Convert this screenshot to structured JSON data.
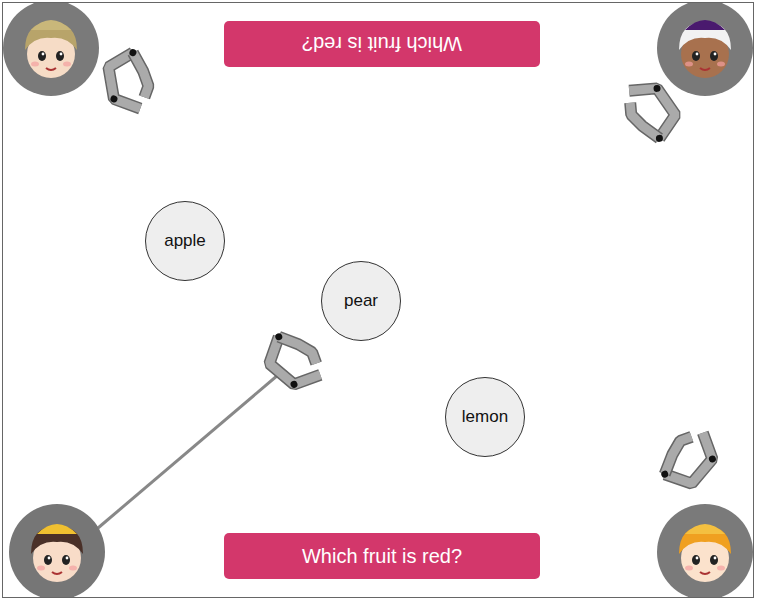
{
  "prompts": [
    {
      "text": "Which fruit is red?",
      "flipped": true
    },
    {
      "text": "Which fruit is red?",
      "flipped": false
    }
  ],
  "players": [
    {
      "claw_extended": false
    },
    {
      "claw_extended": false
    },
    {
      "claw_extended": true
    },
    {
      "claw_extended": false
    }
  ],
  "fruits": [
    {
      "label": "apple"
    },
    {
      "label": "pear"
    },
    {
      "label": "lemon"
    }
  ]
}
